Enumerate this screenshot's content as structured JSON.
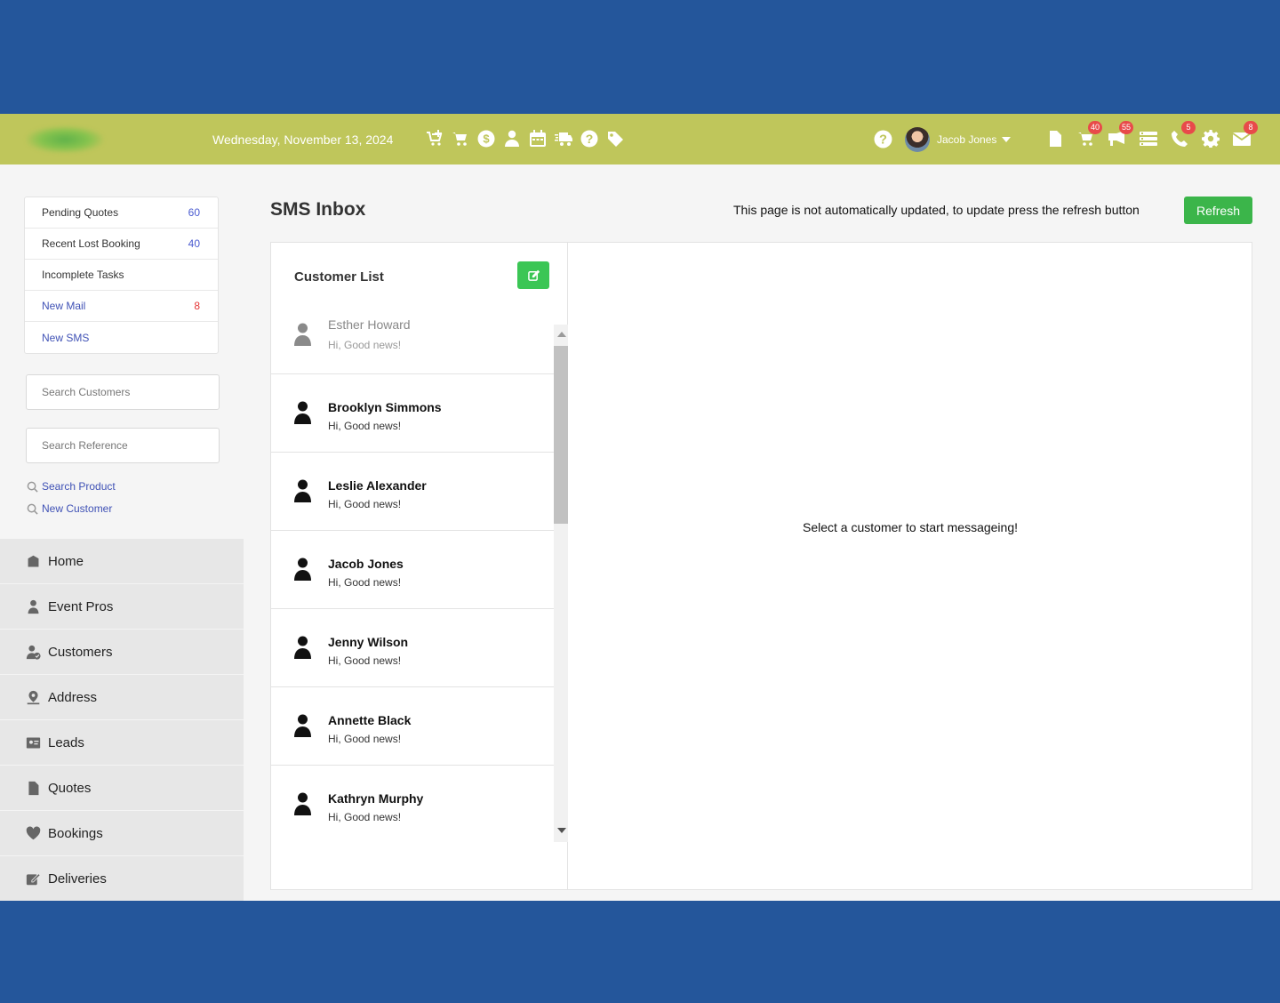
{
  "header": {
    "date": "Wednesday, November 13, 2024",
    "quick_icons": [
      "cart-plus-icon",
      "cart-icon",
      "dollar-icon",
      "user-icon",
      "calendar-icon",
      "truck-icon",
      "question-icon",
      "tag-icon"
    ],
    "user_name": "Jacob Jones",
    "badges": {
      "orders": "40",
      "messages": "55",
      "calls": "5",
      "mail": "8"
    }
  },
  "sidebar": {
    "quick_links": [
      {
        "label": "Pending Quotes",
        "count": "60"
      },
      {
        "label": "Recent Lost Booking",
        "count": "40"
      },
      {
        "label": "Incomplete Tasks",
        "count": ""
      },
      {
        "label": "New Mail",
        "count": "8"
      },
      {
        "label": "New SMS",
        "count": ""
      }
    ],
    "search_customers_placeholder": "Search Customers",
    "search_reference_placeholder": "Search Reference",
    "search_product": "Search Product",
    "new_customer": "New Customer",
    "nav": [
      "Home",
      "Event Pros",
      "Customers",
      "Address",
      "Leads",
      "Quotes",
      "Bookings",
      "Deliveries"
    ]
  },
  "main": {
    "title": "SMS Inbox",
    "notice": "This page is not automatically updated, to update press the refresh button",
    "refresh_label": "Refresh",
    "customer_list_title": "Customer List",
    "customers": [
      {
        "name": "Esther Howard",
        "message": "Hi, Good news!"
      },
      {
        "name": "Brooklyn Simmons",
        "message": "Hi, Good news!"
      },
      {
        "name": "Leslie Alexander",
        "message": "Hi, Good news!"
      },
      {
        "name": "Jacob Jones",
        "message": "Hi, Good news!"
      },
      {
        "name": "Jenny Wilson",
        "message": "Hi, Good news!"
      },
      {
        "name": "Annette Black",
        "message": "Hi, Good news!"
      },
      {
        "name": "Kathryn Murphy",
        "message": "Hi, Good news!"
      }
    ],
    "empty_message": "Select a customer to start messageing!"
  },
  "colors": {
    "topbar": "#bfc65b",
    "frame": "#24569b",
    "accent_green": "#3bb54a",
    "badge_red": "#e84a4a",
    "link_blue": "#3f51b5"
  }
}
